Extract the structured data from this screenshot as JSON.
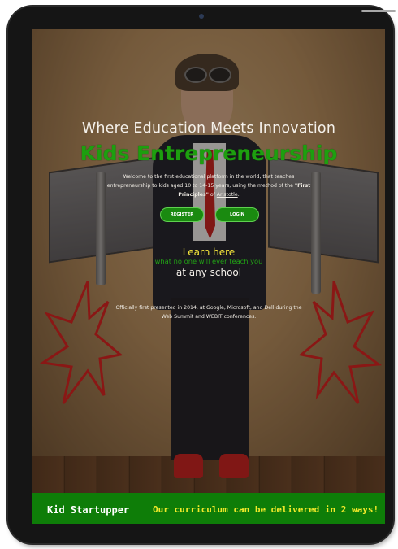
{
  "hero": {
    "headline": "Where Education Meets Innovation",
    "title": "Kids Entrepreneurship",
    "description_parts": [
      "Welcome to the first educational platform in the world, that teaches entrepreneurship to kids aged 10 to 14-15 years, using the method of the ",
      "\"First Principles\"",
      " of ",
      "Aristotle",
      "."
    ],
    "register_label": "REGISTER",
    "login_label": "LOGIN",
    "learn_here": "Learn here",
    "nobody_teach": "what no one will ever teach you",
    "any_school": "at any school",
    "official": "Officially first presented in 2014, at Google, Microsoft, and Dell during the Web Summit and WEBIT conferences."
  },
  "banner": {
    "brand": "Kid Startupper",
    "tagline": "Our curriculum can be delivered in 2 ways!"
  },
  "colors": {
    "title_green": "#1d9f0f",
    "button_green": "#1a8a10",
    "banner_green": "#0e7d08",
    "tagline_yellow": "#f2ea2a",
    "learn_yellow": "#f4e53a"
  },
  "icons": [
    "camera-icon",
    "fire-drawing-icon"
  ]
}
